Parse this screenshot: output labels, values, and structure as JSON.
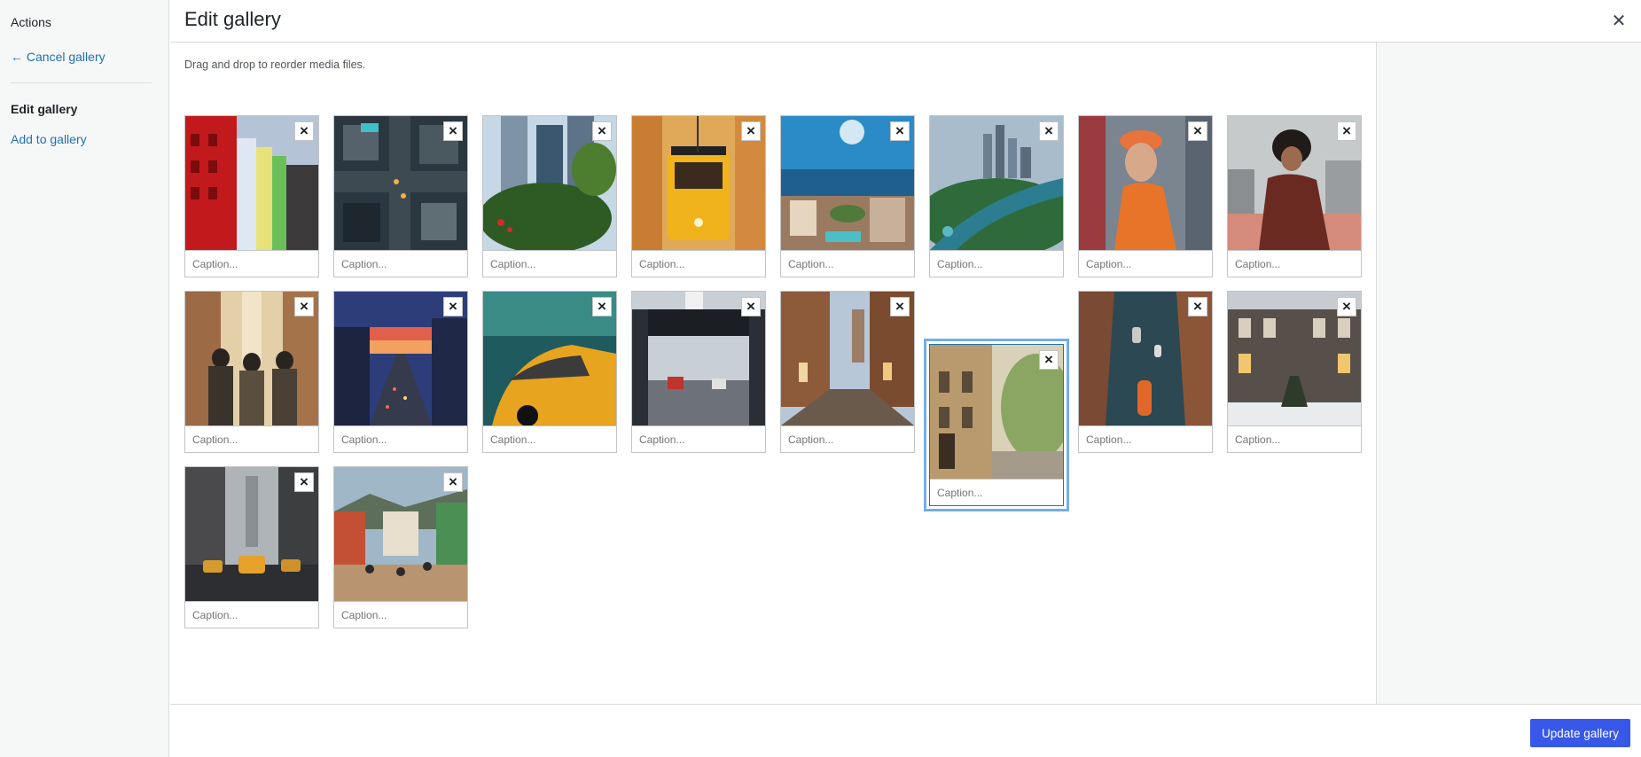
{
  "sidebar": {
    "heading": "Actions",
    "cancel_link": "← Cancel gallery",
    "edit_label": "Edit gallery",
    "add_link": "Add to gallery"
  },
  "header": {
    "title": "Edit gallery",
    "close_icon": "close-icon"
  },
  "instructions": "Drag and drop to reorder media files.",
  "gallery": {
    "caption_placeholder": "Caption...",
    "selected_index": 13,
    "items": [
      {
        "name": "colorful-buildings",
        "remove": "×"
      },
      {
        "name": "aerial-intersection",
        "remove": "×"
      },
      {
        "name": "skyscrapers-trees",
        "remove": "×"
      },
      {
        "name": "yellow-tram",
        "remove": "×"
      },
      {
        "name": "coastal-city",
        "remove": "×"
      },
      {
        "name": "river-skyline",
        "remove": "×"
      },
      {
        "name": "woman-orange-cap",
        "remove": "×"
      },
      {
        "name": "woman-rooftop",
        "remove": "×"
      },
      {
        "name": "people-walking",
        "remove": "×"
      },
      {
        "name": "sunset-traffic",
        "remove": "×"
      },
      {
        "name": "taxi-motion",
        "remove": "×"
      },
      {
        "name": "bridge-street",
        "remove": "×"
      },
      {
        "name": "cobblestone-street",
        "remove": "×"
      },
      {
        "name": "paris-street",
        "remove": "×"
      },
      {
        "name": "canal-boats",
        "remove": "×"
      },
      {
        "name": "brownstones",
        "remove": "×"
      },
      {
        "name": "taxi-street",
        "remove": "×"
      },
      {
        "name": "market-street",
        "remove": "×"
      }
    ]
  },
  "footer": {
    "update_label": "Update gallery"
  },
  "colors": {
    "link": "#2271b1",
    "primary": "#3858e9",
    "selection": "#72aee6"
  }
}
